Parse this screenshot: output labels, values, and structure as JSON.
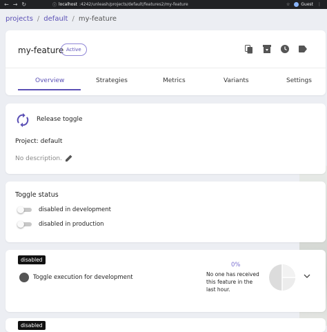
{
  "browser": {
    "url_host": "localhost",
    "url_path": ":4242/unleash/projects/default/features2/my-feature",
    "profile": "Guest"
  },
  "breadcrumb": {
    "items": [
      "projects",
      "default"
    ],
    "current": "my-feature",
    "separator": "/"
  },
  "header": {
    "feature_name": "my-feature",
    "status_badge": "Active",
    "icons": [
      "copy-icon",
      "archive-icon",
      "history-icon",
      "tag-icon"
    ]
  },
  "tabs": [
    {
      "label": "Overview",
      "active": true
    },
    {
      "label": "Strategies",
      "active": false
    },
    {
      "label": "Metrics",
      "active": false
    },
    {
      "label": "Variants",
      "active": false
    },
    {
      "label": "Settings",
      "active": false
    }
  ],
  "info": {
    "type_label": "Release toggle",
    "project": "Project: default",
    "description": "No description."
  },
  "toggle_status": {
    "title": "Toggle status",
    "environments": [
      {
        "label": "disabled in development",
        "enabled": false
      },
      {
        "label": "disabled in production",
        "enabled": false
      }
    ]
  },
  "env_cards": [
    {
      "badge": "disabled",
      "toggle_text": "Toggle execution for development",
      "percent": "0%",
      "metrics_text": "No one has received this feature in the last hour."
    },
    {
      "badge": "disabled"
    }
  ],
  "colors": {
    "accent": "#5a4fb5",
    "page_background": "#eceef3",
    "badge_dark": "#111111"
  }
}
